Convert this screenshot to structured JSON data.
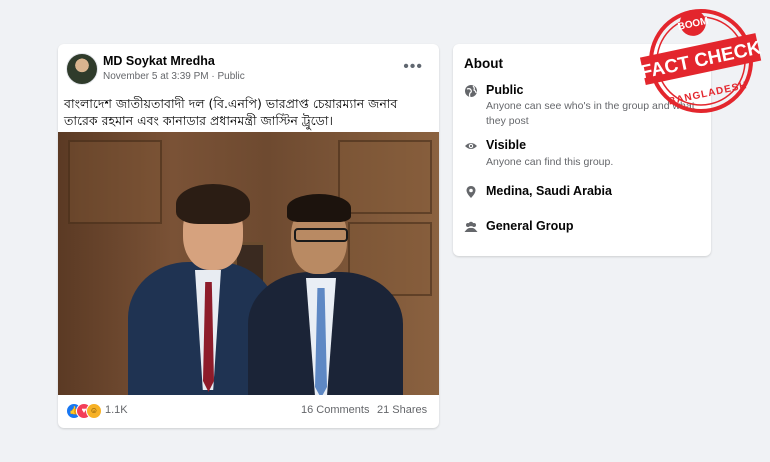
{
  "post": {
    "author": "MD Soykat Mredha",
    "date": "November 5 at 3:39 PM",
    "audience": "Public",
    "more_label": "•••",
    "text": "বাংলাদেশ জাতীয়তাবাদী দল (বি.এনপি) ভারপ্রাপ্ত চেয়ারম্যান জনাব তারেক রহমান এবং কানাডার প্রধানমন্ত্রী জাস্টিন ট্রুডো।",
    "reaction_count": "1.1K",
    "comments": "16 Comments",
    "shares": "21 Shares"
  },
  "about": {
    "title": "About",
    "items": [
      {
        "icon": "globe-icon",
        "label": "Public",
        "sub": "Anyone can see who's in the group and what they post"
      },
      {
        "icon": "eye-icon",
        "label": "Visible",
        "sub": "Anyone can find this group."
      },
      {
        "icon": "location-pin-icon",
        "label": "Medina, Saudi Arabia",
        "sub": ""
      },
      {
        "icon": "people-icon",
        "label": "General Group",
        "sub": ""
      }
    ]
  },
  "stamp": {
    "top": "BOOM",
    "middle": "FACT CHECK",
    "bottom": "BANGLADESH",
    "color": "#e3262d"
  },
  "colors": {
    "background": "#f0f2f5",
    "like": "#1877f2",
    "love": "#f33e58",
    "haha": "#f7b125"
  }
}
